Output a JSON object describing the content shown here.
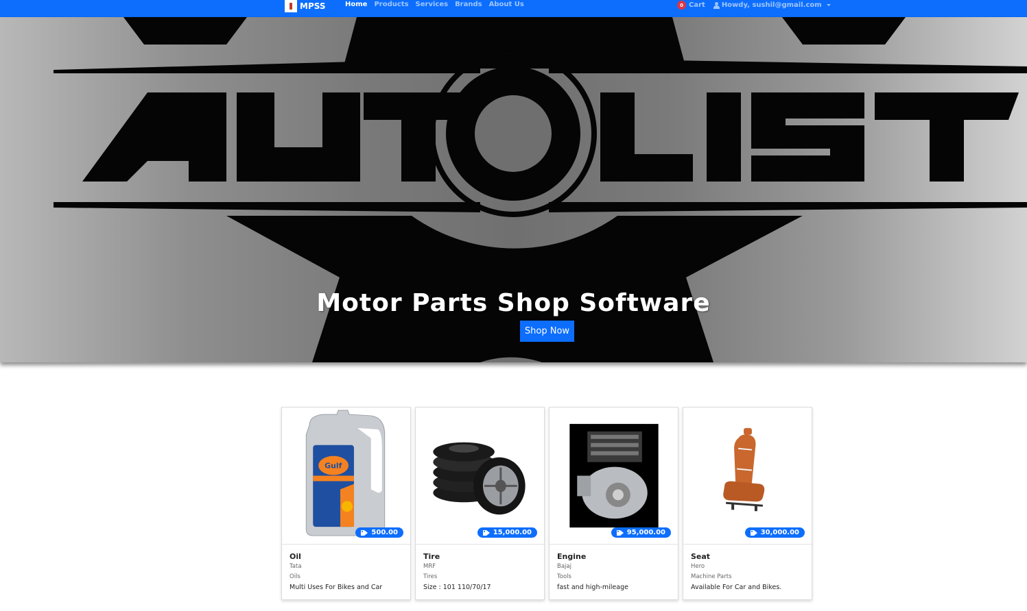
{
  "navbar": {
    "brand": "MPSS",
    "links": [
      "Home",
      "Products",
      "Services",
      "Brands",
      "About Us"
    ],
    "cart_count": "0",
    "cart_label": "Cart",
    "user_greeting": "Howdy, sushil@gmail.com"
  },
  "hero": {
    "logo_text": "AUTOLIST",
    "title": "Motor Parts Shop Software",
    "button": "Shop Now"
  },
  "products": [
    {
      "name": "Oil",
      "brand": "Tata",
      "category": "Oils",
      "description": "Multi Uses For Bikes and Car",
      "price": "500.00",
      "image": "oil-bottle"
    },
    {
      "name": "Tire",
      "brand": "MRF",
      "category": "Tires",
      "description": "Size : 101 110/70/17",
      "price": "15,000.00",
      "image": "tire-stack"
    },
    {
      "name": "Engine",
      "brand": "Bajaj",
      "category": "Tools",
      "description": "fast and high-mileage",
      "price": "95,000.00",
      "image": "engine"
    },
    {
      "name": "Seat",
      "brand": "Hero",
      "category": "Machine Parts",
      "description": "Available For Car and Bikes.",
      "price": "30,000.00",
      "image": "car-seat"
    }
  ],
  "colors": {
    "primary": "#0d6efd",
    "badge": "#dc3545"
  }
}
